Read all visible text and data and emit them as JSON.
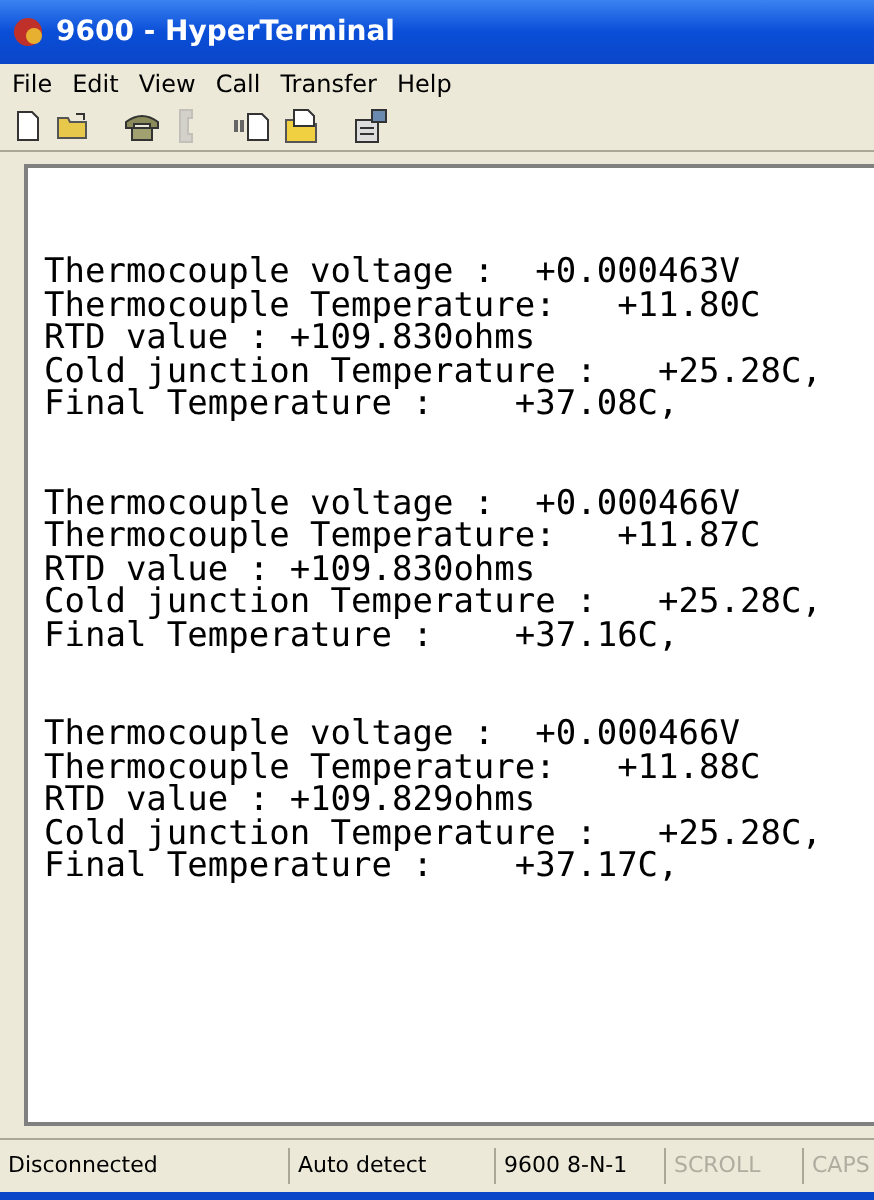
{
  "window": {
    "title": "9600 - HyperTerminal"
  },
  "menu": [
    "File",
    "Edit",
    "View",
    "Call",
    "Transfer",
    "Help"
  ],
  "toolbar": [
    {
      "kind": "new",
      "disabled": false
    },
    {
      "kind": "open",
      "disabled": false
    },
    {
      "kind": "call",
      "disabled": false
    },
    {
      "kind": "hangup",
      "disabled": true
    },
    {
      "kind": "send",
      "disabled": false
    },
    {
      "kind": "receive",
      "disabled": false
    },
    {
      "kind": "properties",
      "disabled": false
    }
  ],
  "terminal": {
    "blocks": [
      [
        "Thermocouple voltage :  +0.000463V",
        "Thermocouple Temperature:   +11.80C",
        "RTD value : +109.830ohms",
        "Cold junction Temperature :   +25.28C,",
        "Final Temperature :    +37.08C,"
      ],
      [
        "Thermocouple voltage :  +0.000466V",
        "Thermocouple Temperature:   +11.87C",
        "RTD value : +109.830ohms",
        "Cold junction Temperature :   +25.28C,",
        "Final Temperature :    +37.16C,"
      ],
      [
        "Thermocouple voltage :  +0.000466V",
        "Thermocouple Temperature:   +11.88C",
        "RTD value : +109.829ohms",
        "Cold junction Temperature :   +25.28C,",
        "Final Temperature :    +37.17C,"
      ]
    ]
  },
  "status_bar": [
    {
      "text": "Disconnected",
      "disabled": false
    },
    {
      "text": "Auto detect",
      "disabled": false
    },
    {
      "text": "9600 8-N-1",
      "disabled": false
    },
    {
      "text": "SCROLL",
      "disabled": true
    },
    {
      "text": "CAPS",
      "disabled": true
    }
  ]
}
